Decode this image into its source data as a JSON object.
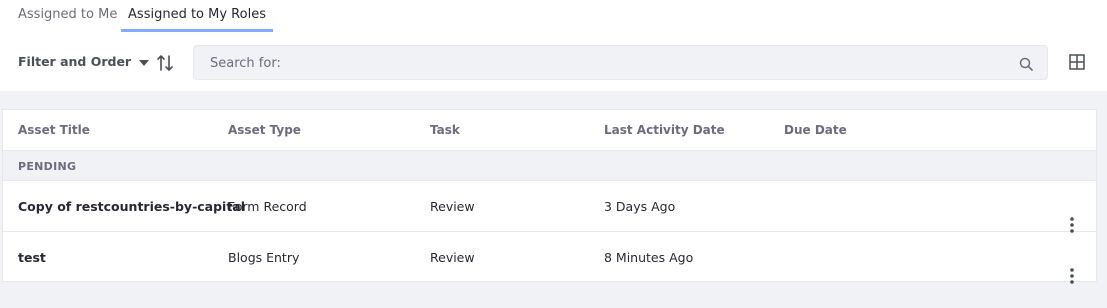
{
  "tabs": [
    {
      "label": "Assigned to Me"
    },
    {
      "label": "Assigned to My Roles"
    }
  ],
  "toolbar": {
    "filter_label": "Filter and Order",
    "search_placeholder": "Search for:"
  },
  "table": {
    "columns": [
      "Asset Title",
      "Asset Type",
      "Task",
      "Last Activity Date",
      "Due Date"
    ],
    "group_label": "PENDING",
    "rows": [
      {
        "title": "Copy of restcountries-by-capital",
        "type": "Form Record",
        "task": "Review",
        "last_activity": "3 Days Ago",
        "due": ""
      },
      {
        "title": "test",
        "type": "Blogs Entry",
        "task": "Review",
        "last_activity": "8 Minutes Ago",
        "due": ""
      }
    ]
  },
  "icons": {
    "filter": "caret-down-icon",
    "sort": "order-arrow-icon",
    "search": "search-icon",
    "view": "cards-view-icon",
    "row_actions": "ellipsis-v-icon"
  },
  "colors": {
    "active_tab_underline": "#80acff",
    "page_background": "#f1f2f5"
  }
}
